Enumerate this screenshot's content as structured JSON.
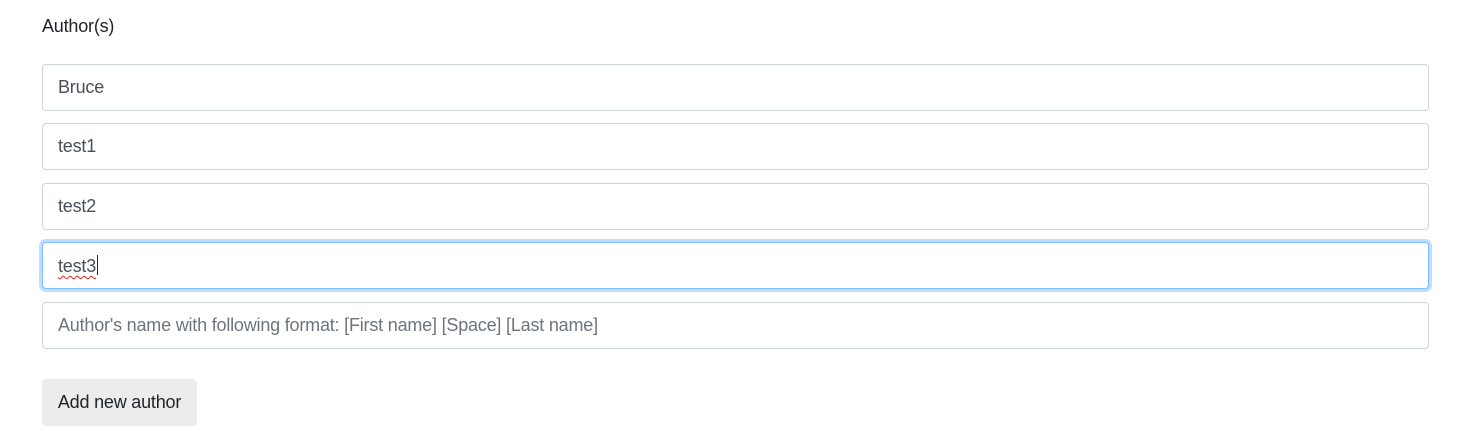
{
  "authors": {
    "label": "Author(s)",
    "inputs": [
      {
        "value": "Bruce"
      },
      {
        "value": "test1"
      },
      {
        "value": "test2"
      },
      {
        "value": "test3",
        "focused": true,
        "spellcheck_error": true
      }
    ],
    "new_input": {
      "value": "",
      "placeholder": "Author's name with following format: [First name] [Space] [Last name]"
    },
    "add_button_label": "Add new author"
  },
  "colors": {
    "input_border": "#ced4da",
    "focus_border": "#80bdff",
    "button_bg": "#ececec",
    "spell_underline": "#e02424"
  }
}
